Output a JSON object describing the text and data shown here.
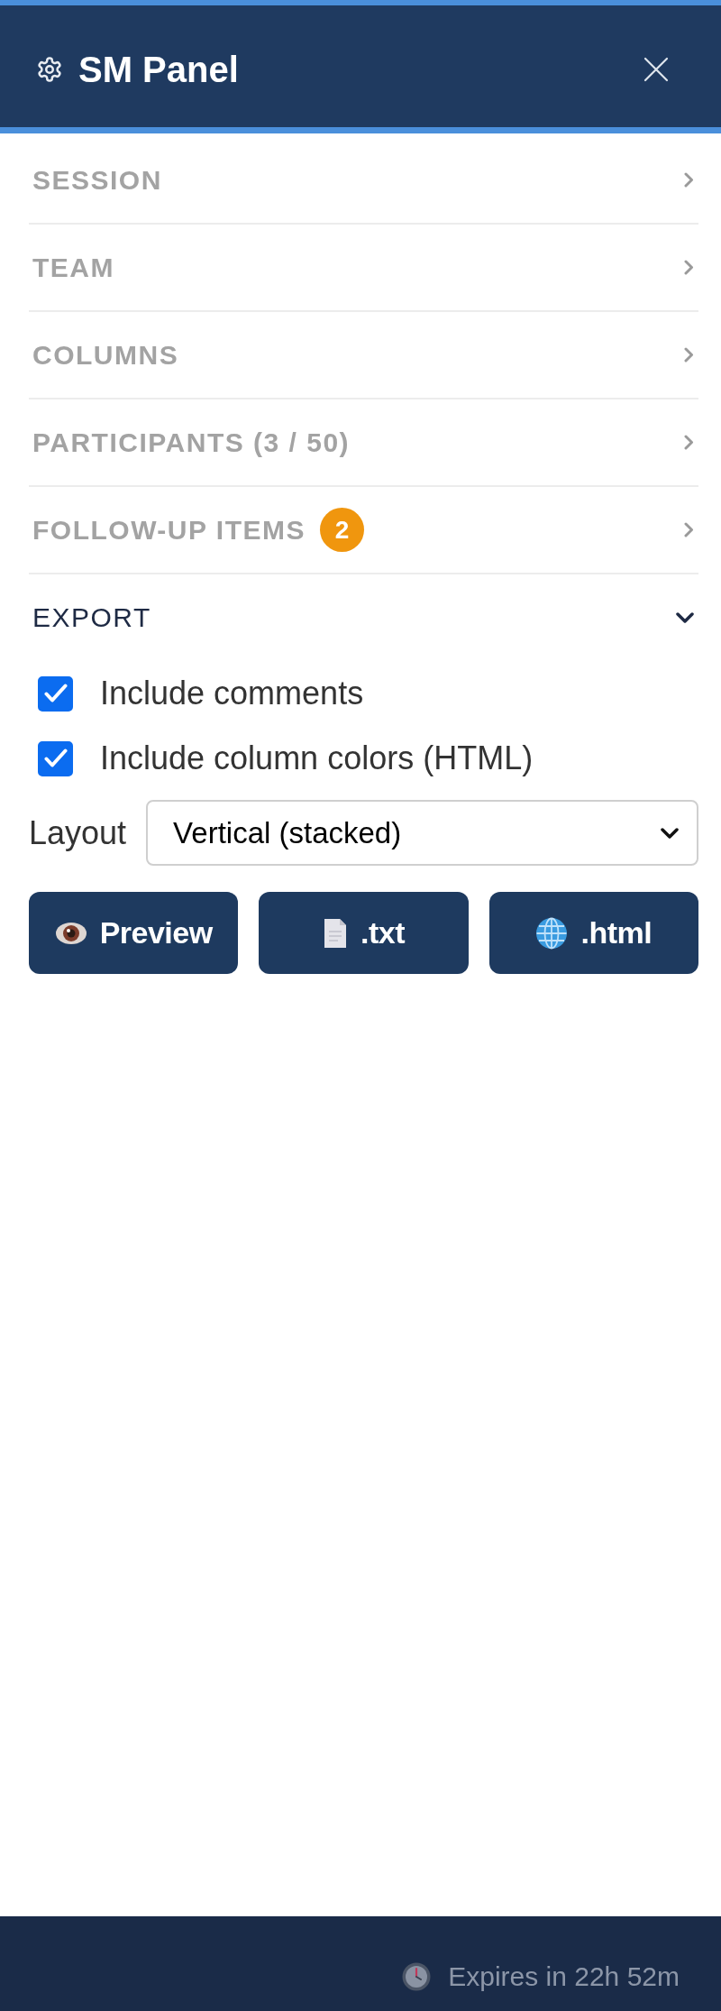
{
  "header": {
    "title": "SM Panel"
  },
  "sections": [
    {
      "label": "SESSION",
      "expanded": false
    },
    {
      "label": "TEAM",
      "expanded": false
    },
    {
      "label": "COLUMNS",
      "expanded": false
    },
    {
      "label": "PARTICIPANTS (3 / 50)",
      "expanded": false
    },
    {
      "label": "FOLLOW-UP ITEMS",
      "badge": "2",
      "expanded": false
    },
    {
      "label": "EXPORT",
      "expanded": true,
      "options": [
        {
          "label": "Include comments",
          "checked": true
        },
        {
          "label": "Include column colors (HTML)",
          "checked": true
        }
      ],
      "layout": {
        "label": "Layout",
        "value": "Vertical (stacked)"
      },
      "buttons": [
        {
          "kind": "preview",
          "label": "Preview"
        },
        {
          "kind": "txt",
          "label": ".txt"
        },
        {
          "kind": "html",
          "label": ".html"
        }
      ]
    }
  ],
  "footer": {
    "expiry": "Expires in 22h 52m"
  }
}
